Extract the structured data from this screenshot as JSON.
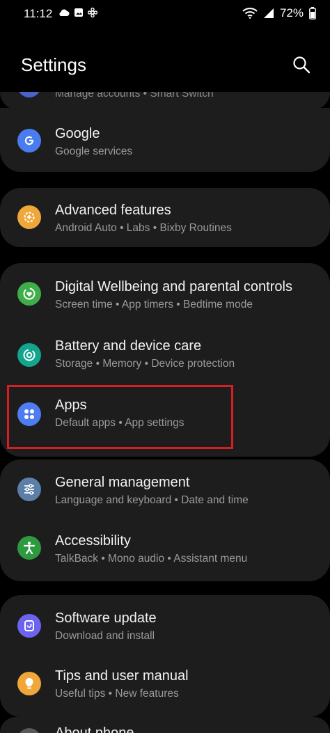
{
  "status": {
    "time": "11:12",
    "battery": "72%"
  },
  "header": {
    "title": "Settings"
  },
  "partial_top": {
    "subtitle": "Manage accounts  •  Smart Switch"
  },
  "cards": [
    {
      "items": [
        {
          "title": "Google",
          "subtitle": "Google services",
          "icon": "google-icon",
          "color": "#4a7cf0"
        }
      ]
    },
    {
      "items": [
        {
          "title": "Advanced features",
          "subtitle": "Android Auto  •  Labs  •  Bixby Routines",
          "icon": "gear-plus-icon",
          "color": "#f0a73a"
        }
      ]
    },
    {
      "items": [
        {
          "title": "Digital Wellbeing and parental controls",
          "subtitle": "Screen time  •  App timers  •  Bedtime mode",
          "icon": "wellbeing-icon",
          "color": "#3fae4a"
        },
        {
          "title": "Battery and device care",
          "subtitle": "Storage  •  Memory  •  Device protection",
          "icon": "device-care-icon",
          "color": "#12a48d"
        },
        {
          "title": "Apps",
          "subtitle": "Default apps  •  App settings",
          "icon": "apps-icon",
          "color": "#4f7cf3"
        }
      ]
    },
    {
      "items": [
        {
          "title": "General management",
          "subtitle": "Language and keyboard  •  Date and time",
          "icon": "sliders-icon",
          "color": "#5b7fa6"
        },
        {
          "title": "Accessibility",
          "subtitle": "TalkBack  •  Mono audio  •  Assistant menu",
          "icon": "accessibility-icon",
          "color": "#2e9a3f"
        }
      ]
    },
    {
      "items": [
        {
          "title": "Software update",
          "subtitle": "Download and install",
          "icon": "update-icon",
          "color": "#6c63f0"
        },
        {
          "title": "Tips and user manual",
          "subtitle": "Useful tips  •  New features",
          "icon": "lightbulb-icon",
          "color": "#f0a73a"
        }
      ]
    }
  ],
  "partial_bottom": {
    "title": "About phone"
  },
  "highlight_color": "#d81e25"
}
